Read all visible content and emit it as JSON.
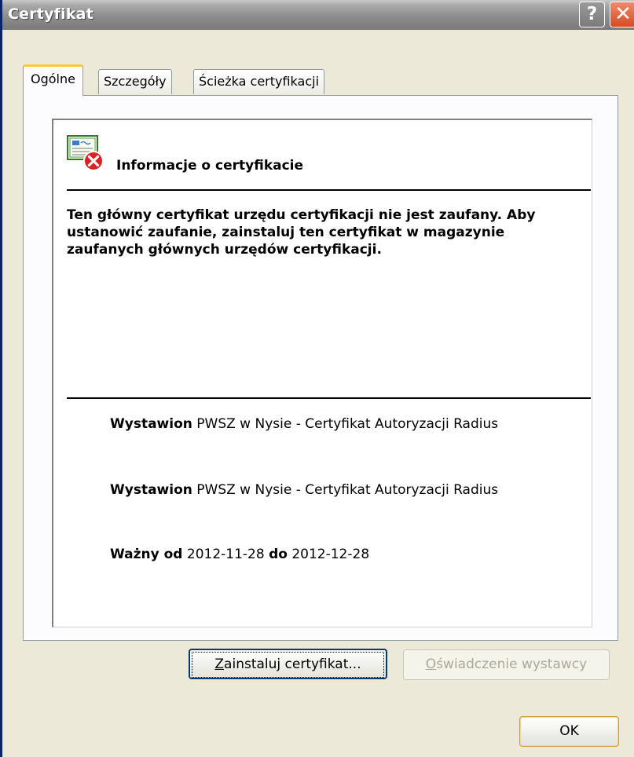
{
  "window": {
    "title": "Certyfikat",
    "help_glyph": "?",
    "close_glyph": "✕"
  },
  "tabs": [
    {
      "label": "Ogólne",
      "active": true
    },
    {
      "label": "Szczegóły",
      "active": false
    },
    {
      "label": "Ścieżka certyfikacji",
      "active": false
    }
  ],
  "info": {
    "icon": "certificate-error-icon",
    "heading": "Informacje o certyfikacie",
    "message": "Ten główny certyfikat urzędu certyfikacji nie jest zaufany. Aby ustanowić zaufanie, zainstaluj ten certyfikat w magazynie zaufanych głównych urzędów certyfikacji.",
    "issued_to_label": "Wystawion",
    "issued_to_value": "PWSZ w Nysie - Certyfikat Autoryzacji Radius",
    "issued_by_label": "Wystawion",
    "issued_by_value": "PWSZ w Nysie - Certyfikat Autoryzacji Radius",
    "valid_from_label": "Ważny od",
    "valid_from": "2012-11-28",
    "valid_to_label": "do",
    "valid_to": "2012-12-28"
  },
  "buttons": {
    "install_first": "Z",
    "install_rest": "ainstaluj certyfikat...",
    "statement_first": "O",
    "statement_rest": "świadczenie wystawcy",
    "ok": "OK"
  },
  "colors": {
    "title_bar": "#8d8d8d",
    "dialog_bg": "#ece9d8",
    "active_tab_accent": "#ffc83c",
    "close_button": "#d84a22"
  }
}
